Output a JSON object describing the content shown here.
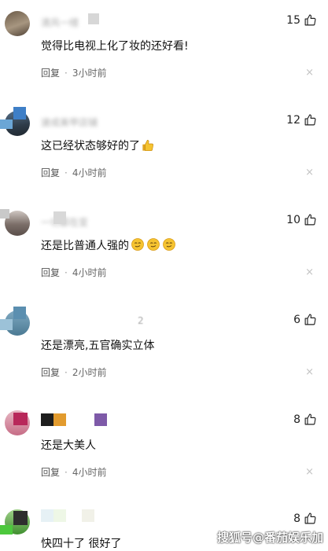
{
  "comments": [
    {
      "username": "清风一缕",
      "text": "觉得比电视上化了妆的还好看!",
      "reply_label": "回复",
      "time": "3小时前",
      "likes": "15",
      "close": "×"
    },
    {
      "username": "速成美甲店铺",
      "text": "这已经状态够好的了",
      "reply_label": "回复",
      "time": "4小时前",
      "likes": "12",
      "close": "×"
    },
    {
      "username": "一切都在变",
      "text": "还是比普通人强的",
      "reply_label": "回复",
      "time": "4小时前",
      "likes": "10",
      "close": "×"
    },
    {
      "username": "2",
      "text": "还是漂亮,五官确实立体",
      "reply_label": "回复",
      "time": "2小时前",
      "likes": "6",
      "close": "×"
    },
    {
      "username": "",
      "text": "还是大美人",
      "reply_label": "回复",
      "time": "4小时前",
      "likes": "8",
      "close": "×"
    },
    {
      "username": "",
      "text": "快四十了 很好了",
      "reply_label": "",
      "time": "",
      "likes": "8",
      "close": ""
    }
  ],
  "watermark": "搜狐号@番茄娱乐加",
  "icons": {
    "like": "thumbs-up-icon",
    "close": "close-icon",
    "emoji_thumb": "thumbs-up-emoji-icon",
    "emoji_smile": "smirk-emoji-icon"
  },
  "colors": {
    "text": "#111111",
    "meta": "#666666",
    "close": "#c3c3c3",
    "emoji": "#f5c330"
  }
}
